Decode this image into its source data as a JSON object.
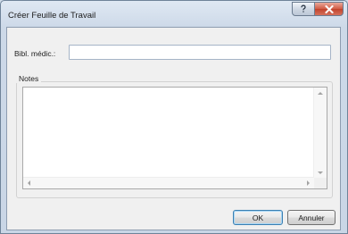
{
  "window": {
    "title": "Créer Feuille de Travail"
  },
  "titlebar_buttons": {
    "help_icon": "question-mark",
    "close_icon": "x-mark"
  },
  "form": {
    "bibl_label": "Bibl. médic.:",
    "bibl_value": "",
    "notes_legend": "Notes",
    "notes_value": ""
  },
  "buttons": {
    "ok_label": "OK",
    "cancel_label": "Annuler"
  },
  "colors": {
    "frame": "#cdd9e8",
    "close_button": "#c9452e",
    "default_button_border": "#3c7fb1"
  }
}
